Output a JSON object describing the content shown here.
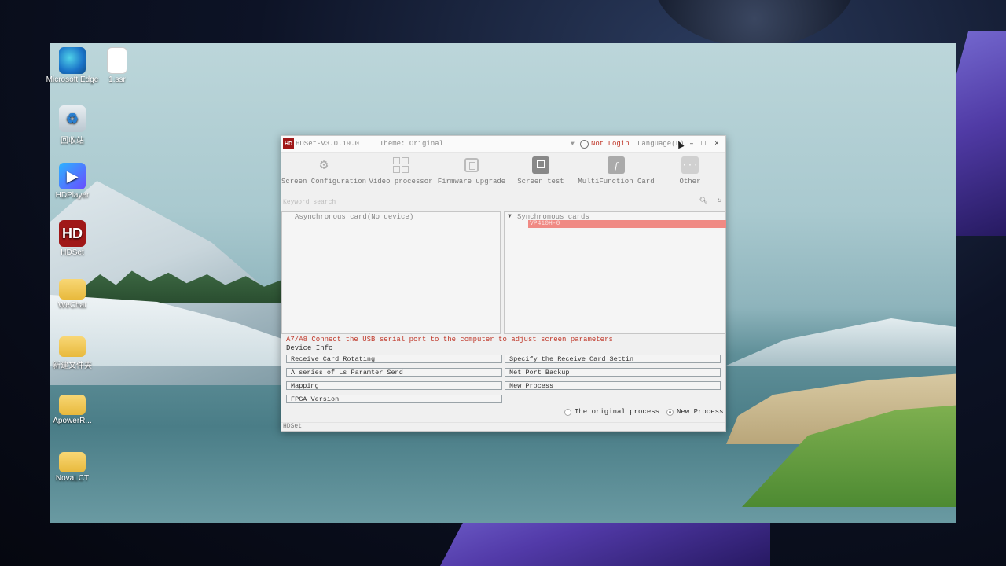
{
  "desktop": {
    "icons": [
      {
        "label": "Microsoft Edge",
        "icon": "edge-icon"
      },
      {
        "label": "1.ssr",
        "icon": "file-icon"
      },
      {
        "label": "回收站",
        "icon": "recycle-bin-icon"
      },
      {
        "label": "HDPlayer",
        "icon": "hdplayer-icon"
      },
      {
        "label": "HDSet",
        "icon": "hdset-icon"
      },
      {
        "label": "WeChat",
        "icon": "folder-icon"
      },
      {
        "label": "新建文件夹",
        "icon": "folder-icon"
      },
      {
        "label": "ApowerR...",
        "icon": "folder-icon"
      },
      {
        "label": "NovaLCT",
        "icon": "folder-icon"
      }
    ]
  },
  "window": {
    "logo": "HD",
    "version": "HDSet-v3.0.19.0",
    "theme": "Theme: Original",
    "login": "Not Login",
    "language": "Language(L)",
    "controls": {
      "minimize": "–",
      "maximize": "□",
      "close": "×"
    }
  },
  "toolbar": {
    "items": [
      {
        "label": "Screen Configuration",
        "icon": "gear-icon"
      },
      {
        "label": "Video processor",
        "icon": "grid-icon"
      },
      {
        "label": "Firmware upgrade",
        "icon": "chip-icon"
      },
      {
        "label": "Screen test",
        "icon": "monitor-icon"
      },
      {
        "label": "MultiFunction Card",
        "icon": "function-icon"
      },
      {
        "label": "Other",
        "icon": "more-icon"
      }
    ]
  },
  "search": {
    "placeholder": "Keyword search"
  },
  "panels": {
    "async_header": "Asynchronous card(No device)",
    "sync_header": "Synchronous cards",
    "sync_item": "VP410H-0"
  },
  "hint": "A7/A8 Connect the USB serial port to the computer to adjust screen parameters",
  "device_info": "Device Info",
  "buttons": {
    "receive_card_rotating": "Receive Card Rotating",
    "specify_receive_card": "Specify the Receive Card Settin",
    "ls_param_send": "A series of Ls Paramter Send",
    "net_port_backup": "Net Port Backup",
    "mapping": "Mapping",
    "new_process": "New Process",
    "fpga_version": "FPGA Version"
  },
  "process": {
    "original": "The original process",
    "new": "New Process",
    "selected": "new"
  },
  "status": "HDSet",
  "colors": {
    "accent_red": "#c0392b",
    "selected_row": "#f08a84",
    "logo_red": "#a01818"
  }
}
